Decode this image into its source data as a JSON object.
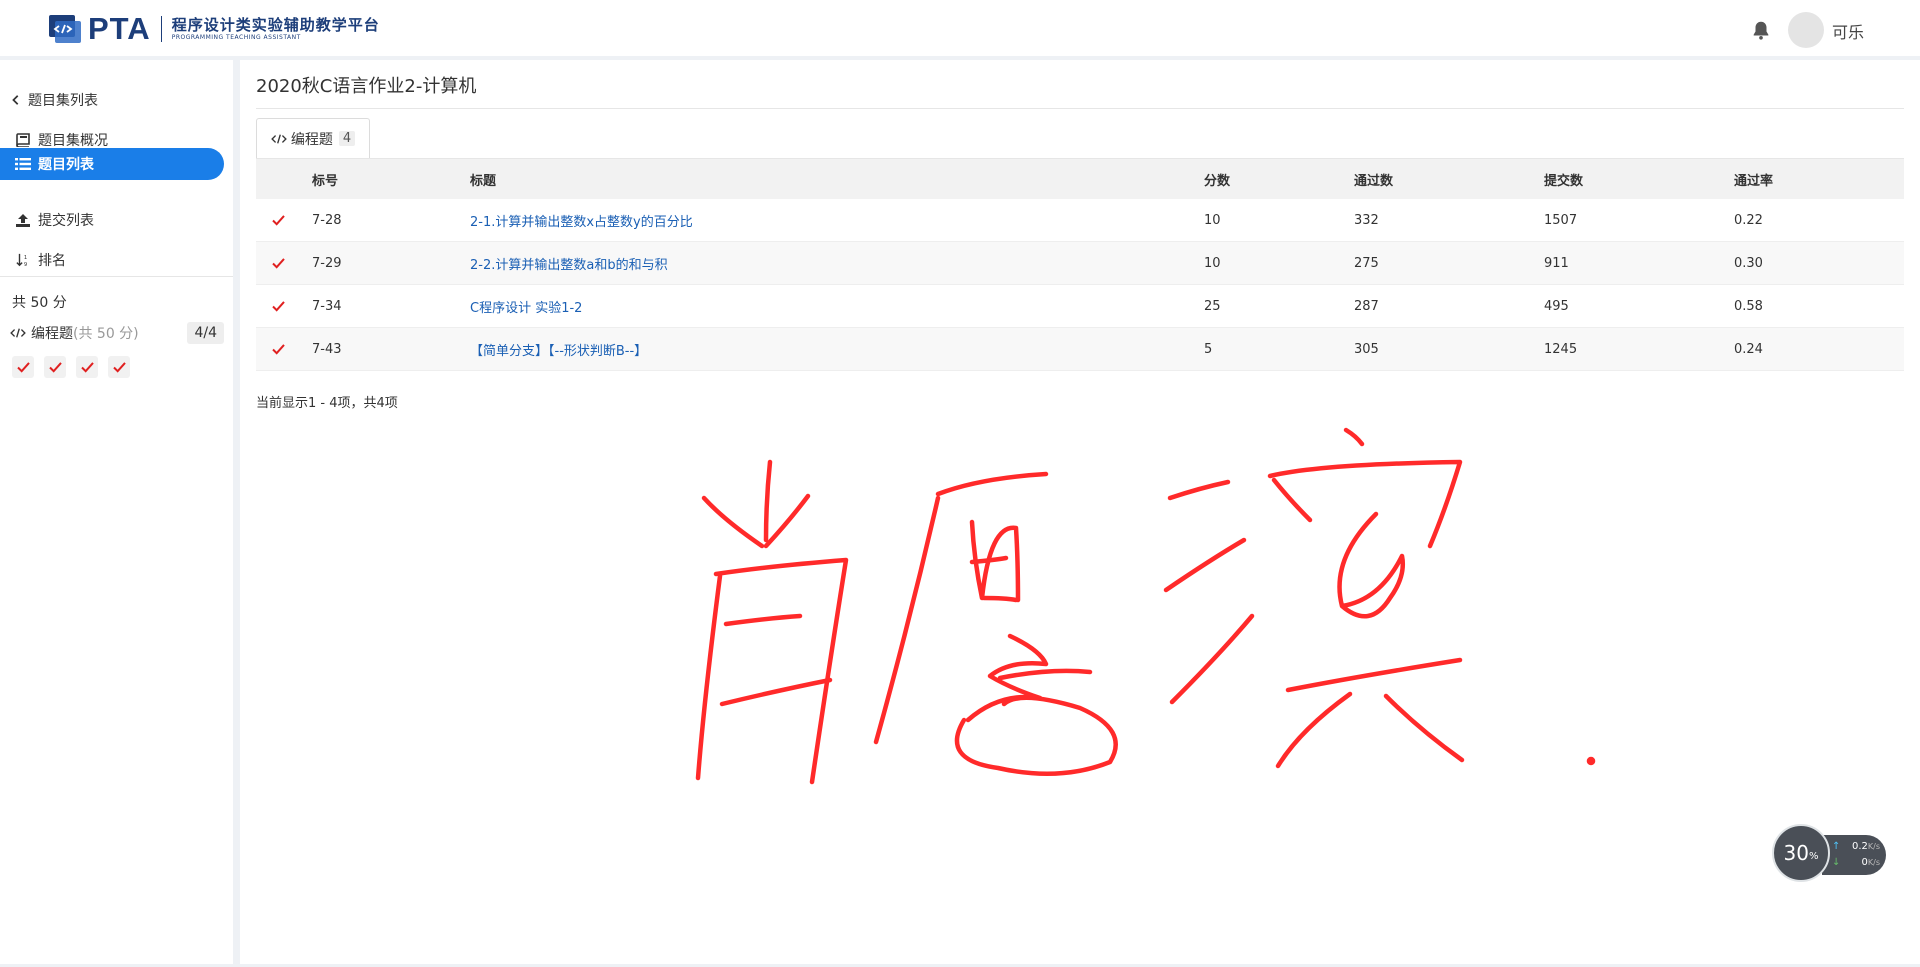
{
  "header": {
    "logo_text": "PTA",
    "logo_cn": "程序设计类实验辅助教学平台",
    "logo_en": "PROGRAMMING TEACHING ASSISTANT",
    "username": "可乐"
  },
  "sidebar": {
    "back_label": "题目集列表",
    "items": [
      {
        "label": "题目集概况",
        "icon": "book-icon"
      },
      {
        "label": "题目列表",
        "icon": "list-icon",
        "active": true
      },
      {
        "label": "提交列表",
        "icon": "upload-icon"
      },
      {
        "label": "排名",
        "icon": "sort-icon"
      }
    ],
    "total_score": "共 50 分",
    "prog_label": "编程题",
    "prog_sub": "(共 50 分)",
    "prog_badge": "4/4"
  },
  "main": {
    "title": "2020秋C语言作业2-计算机",
    "tab_label": "编程题",
    "tab_count": "4",
    "columns": [
      "标号",
      "标题",
      "分数",
      "通过数",
      "提交数",
      "通过率"
    ],
    "rows": [
      {
        "id": "7-28",
        "title": "2-1.计算并输出整数x占整数y的百分比",
        "score": "10",
        "pass": "332",
        "submit": "1507",
        "rate": "0.22"
      },
      {
        "id": "7-29",
        "title": "2-2.计算并输出整数a和b的和与积",
        "score": "10",
        "pass": "275",
        "submit": "911",
        "rate": "0.30"
      },
      {
        "id": "7-34",
        "title": "C程序设计 实验1-2",
        "score": "25",
        "pass": "287",
        "submit": "495",
        "rate": "0.58"
      },
      {
        "id": "7-43",
        "title": "【简单分支】【--形状判断B--】",
        "score": "5",
        "pass": "305",
        "submit": "1245",
        "rate": "0.24"
      }
    ],
    "pager": "当前显示1 - 4项，共4项"
  },
  "speed_widget": {
    "percent": "30",
    "percent_unit": "%",
    "up": "0.2",
    "down": "0",
    "unit": "K/s"
  },
  "colors": {
    "accent": "#1a7ee8",
    "check": "#e02020",
    "ink": "#ff2a2a"
  }
}
